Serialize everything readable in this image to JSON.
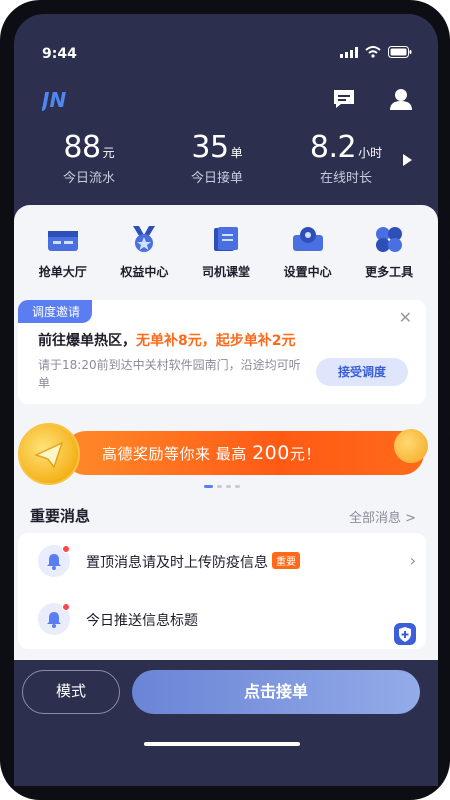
{
  "status_bar": {
    "time": "9:44"
  },
  "header": {
    "logo_text": "JN",
    "icons": [
      "message-icon",
      "profile-icon"
    ]
  },
  "stats": [
    {
      "value": "88",
      "unit": "元",
      "label": "今日流水"
    },
    {
      "value": "35",
      "unit": "单",
      "label": "今日接单"
    },
    {
      "value": "8.2",
      "unit": "小时",
      "label": "在线时长"
    }
  ],
  "tools": [
    {
      "label": "抢单大厅",
      "icon": "grab-order-icon"
    },
    {
      "label": "权益中心",
      "icon": "medal-icon"
    },
    {
      "label": "司机课堂",
      "icon": "book-icon"
    },
    {
      "label": "设置中心",
      "icon": "settings-icon"
    },
    {
      "label": "更多工具",
      "icon": "more-tools-icon"
    }
  ],
  "dispatch": {
    "tag": "调度邀请",
    "title_prefix": "前往爆单热区，",
    "title_highlight": "无单补8元，起步单补2元",
    "description": "请于18:20前到达中关村软件园南门，沿途均可听单",
    "button": "接受调度"
  },
  "banner": {
    "text_prefix": "高德奖励等你来 最高",
    "amount": "200",
    "text_suffix": "元！"
  },
  "messages": {
    "heading": "重要消息",
    "all_link": "全部消息 >",
    "items": [
      {
        "text": "置顶消息请及时上传防疫信息",
        "badge": "重要"
      },
      {
        "text": "今日推送信息标题",
        "badge": ""
      }
    ]
  },
  "bottom": {
    "mode_button": "模式",
    "accept_button": "点击接单"
  },
  "colors": {
    "dark_bg": "#2c2f4e",
    "accent_orange": "#ff6a1a",
    "accent_blue": "#5a7df2"
  }
}
